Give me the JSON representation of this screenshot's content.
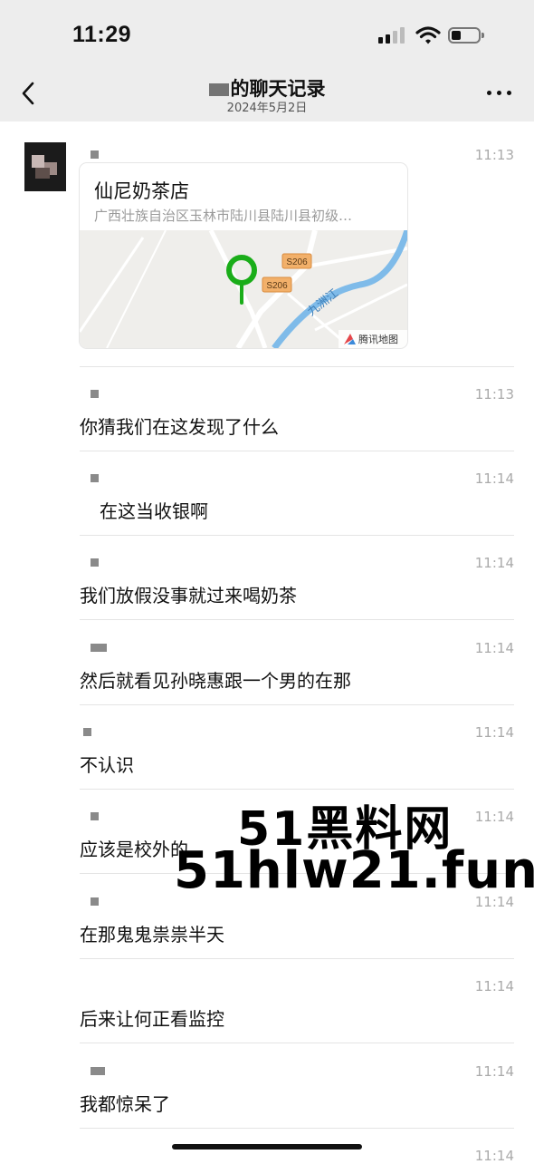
{
  "status": {
    "time": "11:29"
  },
  "header": {
    "title": "的聊天记录",
    "date": "2024年5月2日"
  },
  "location_card": {
    "time": "11:13",
    "shop_name": "仙尼奶茶店",
    "address": "广西壮族自治区玉林市陆川县陆川县初级…",
    "map": {
      "road1": "S206",
      "road2": "S206",
      "river": "九洲江",
      "provider": "腾讯地图"
    }
  },
  "messages": [
    {
      "time": "11:13",
      "text": "你猜我们在这发现了什么"
    },
    {
      "time": "11:14",
      "text": "在这当收银啊"
    },
    {
      "time": "11:14",
      "text": "我们放假没事就过来喝奶茶"
    },
    {
      "time": "11:14",
      "text": "然后就看见孙晓惠跟一个男的在那"
    },
    {
      "time": "11:14",
      "text": "不认识"
    },
    {
      "time": "11:14",
      "text": "应该是校外的"
    },
    {
      "time": "11:14",
      "text": "在那鬼鬼祟祟半天"
    },
    {
      "time": "11:14",
      "text": "后来让何正看监控"
    },
    {
      "time": "11:14",
      "text": "我都惊呆了"
    },
    {
      "time": "11:14",
      "text": ""
    }
  ],
  "watermark": {
    "line1": "51黑料网",
    "line2": "51hlw21.fun"
  },
  "colors": {
    "bar_bg": "#ededed",
    "pin": "#1aad19",
    "river": "#5aa8e6",
    "road_badge": "#f2a65a"
  },
  "icons": [
    "back-chevron-icon",
    "more-icon",
    "map-pin-icon",
    "tencent-map-icon",
    "signal-icon",
    "wifi-icon",
    "battery-icon"
  ]
}
